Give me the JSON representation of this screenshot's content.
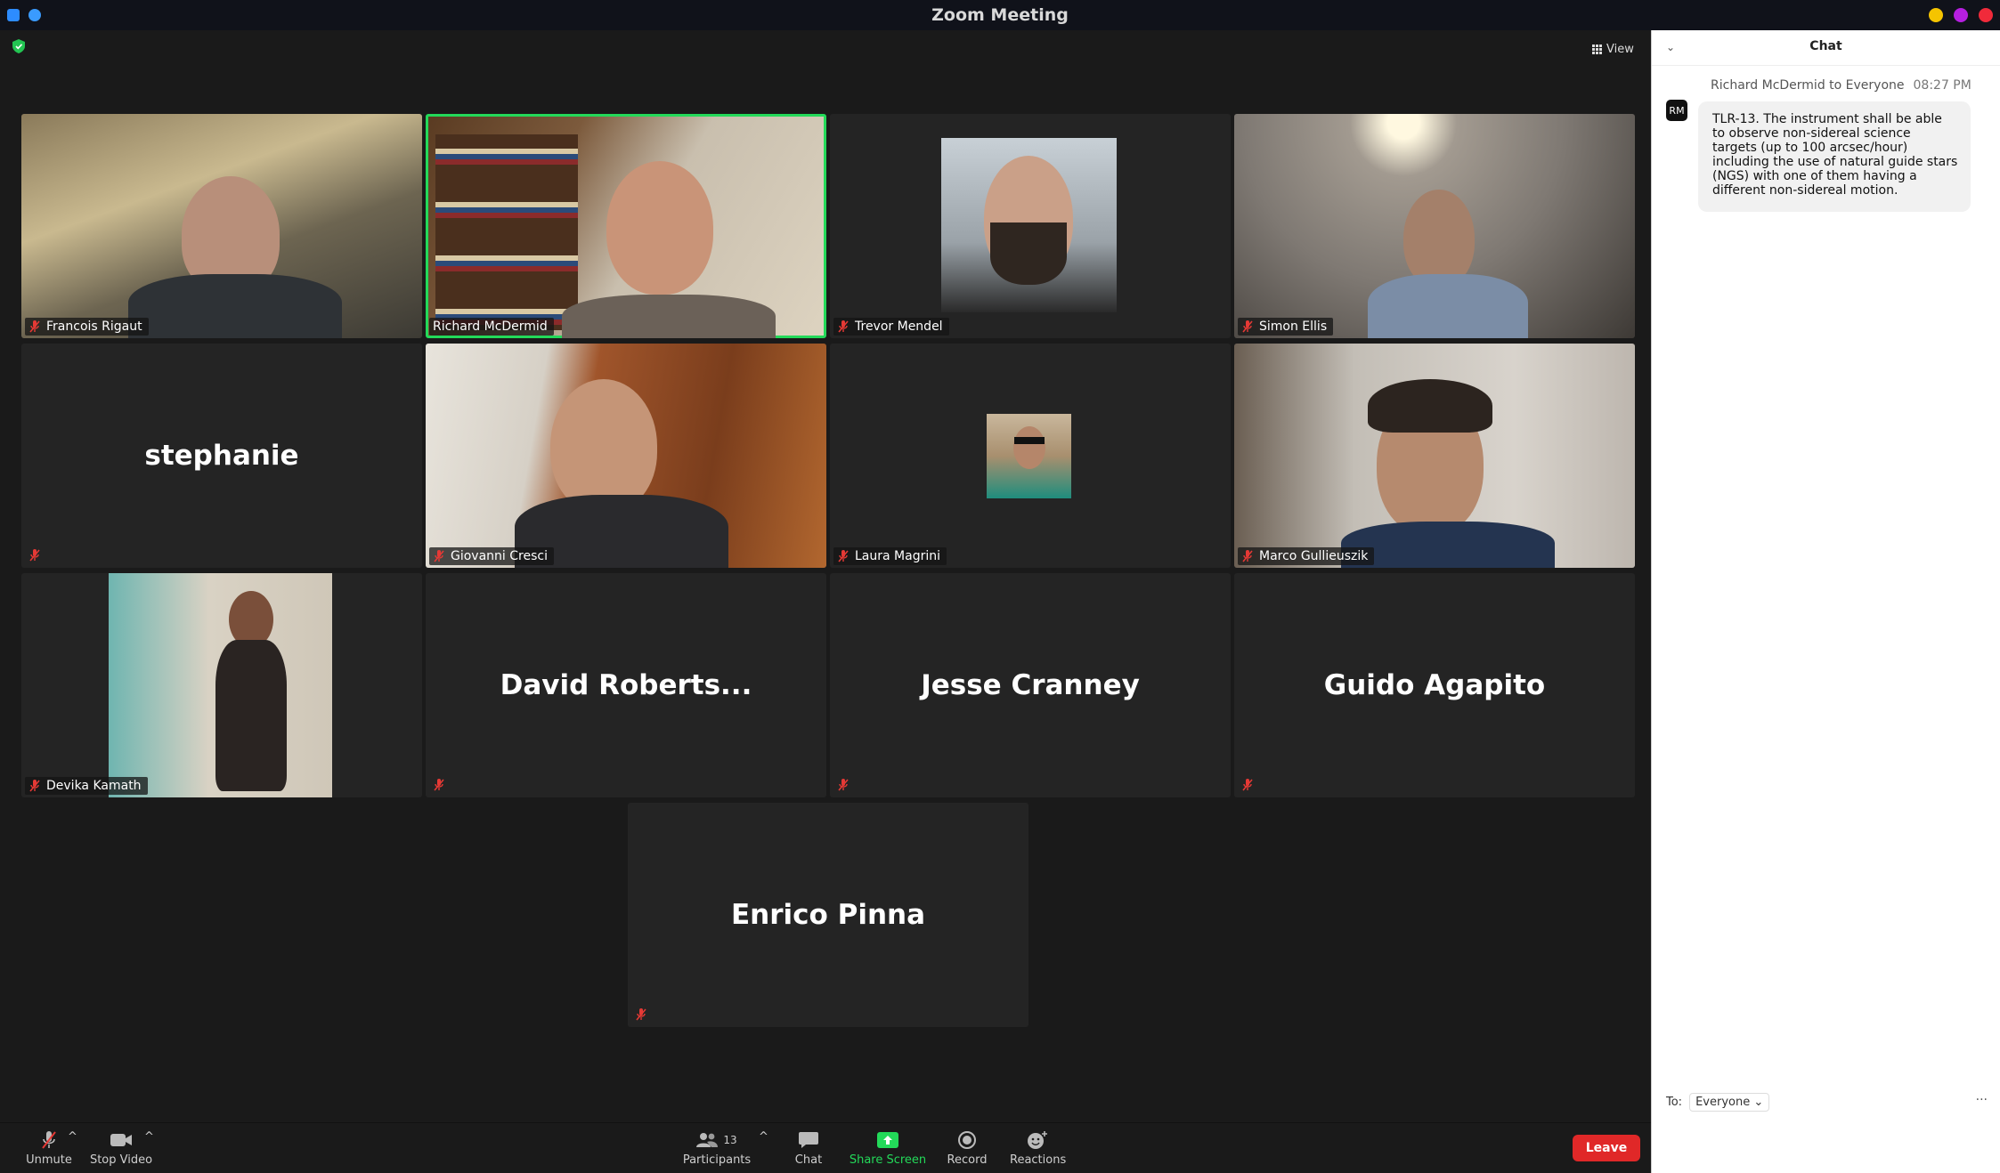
{
  "window": {
    "title": "Zoom Meeting"
  },
  "view_button": {
    "label": "View"
  },
  "participants": [
    {
      "name": "Francois Rigaut",
      "video": true,
      "muted": true,
      "active": false
    },
    {
      "name": "Richard McDermid",
      "video": true,
      "muted": false,
      "active": true
    },
    {
      "name": "Trevor Mendel",
      "video": true,
      "muted": true,
      "active": false
    },
    {
      "name": "Simon Ellis",
      "video": true,
      "muted": true,
      "active": false
    },
    {
      "name": "stephanie",
      "video": false,
      "muted": true,
      "active": false
    },
    {
      "name": "Giovanni Cresci",
      "video": true,
      "muted": true,
      "active": false
    },
    {
      "name": "Laura Magrini",
      "video": true,
      "muted": true,
      "active": false
    },
    {
      "name": "Marco Gullieuszik",
      "video": true,
      "muted": true,
      "active": false
    },
    {
      "name": "Devika Kamath",
      "video": true,
      "muted": true,
      "active": false
    },
    {
      "name": "David Roberts...",
      "video": false,
      "muted": true,
      "active": false
    },
    {
      "name": "Jesse Cranney",
      "video": false,
      "muted": true,
      "active": false
    },
    {
      "name": "Guido Agapito",
      "video": false,
      "muted": true,
      "active": false
    },
    {
      "name": "Enrico Pinna",
      "video": false,
      "muted": true,
      "active": false
    }
  ],
  "chat": {
    "title": "Chat",
    "messages": [
      {
        "sender": "Richard McDermid to Everyone",
        "time": "08:27 PM",
        "avatar": "RM",
        "text": "TLR-13. The instrument shall be able to observe non-sidereal science targets (up to 100 arcsec/hour) including the use of natural guide stars (NGS) with one of them having a different non-sidereal motion."
      }
    ],
    "to_label": "To:",
    "to_value": "Everyone",
    "more": "···"
  },
  "toolbar": {
    "unmute": "Unmute",
    "stop_video": "Stop Video",
    "participants": "Participants",
    "participants_count": "13",
    "chat": "Chat",
    "share_screen": "Share Screen",
    "record": "Record",
    "reactions": "Reactions",
    "leave": "Leave"
  },
  "colors": {
    "active_speaker": "#23d959",
    "leave": "#e02828",
    "share": "#23d959",
    "muted": "#e53935"
  }
}
